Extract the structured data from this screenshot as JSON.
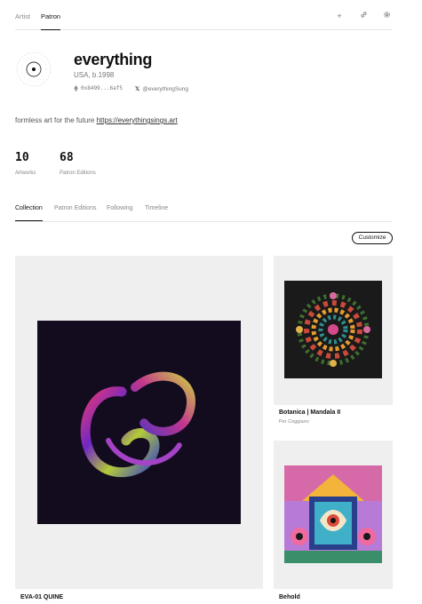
{
  "top_tabs": [
    "Artist",
    "Patron"
  ],
  "top_icons": [
    "plus-icon",
    "link-icon",
    "settings-icon"
  ],
  "profile": {
    "name": "everything",
    "location": "USA, b.1998",
    "wallet": "0x8499...6af5",
    "twitter": "@everythingSung",
    "bio_text": "formless art for the future ",
    "bio_link": "https://everythingsings.art"
  },
  "stats": [
    {
      "value": "10",
      "label": "Artworks"
    },
    {
      "value": "68",
      "label": "Patron Editions"
    }
  ],
  "tabs": [
    "Collection",
    "Patron Editions",
    "Following",
    "Timeline"
  ],
  "customize_label": "Customize",
  "artworks": [
    {
      "title": "EVA-01 QUINE",
      "artist": ""
    },
    {
      "title": "Botanica | Mandala II",
      "artist": "Per Coggiano"
    },
    {
      "title": "Behold",
      "artist": ""
    }
  ]
}
